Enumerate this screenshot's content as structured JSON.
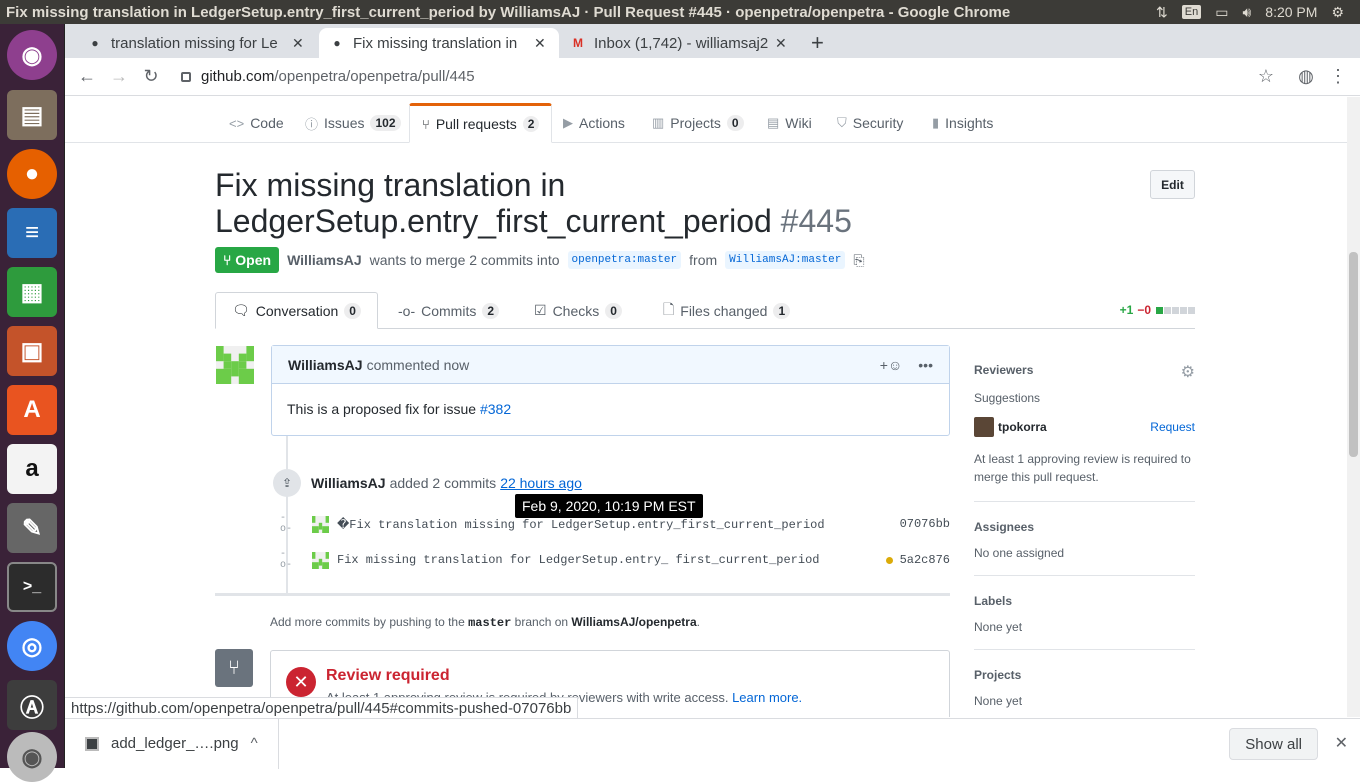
{
  "os": {
    "window_title": "Fix missing translation in LedgerSetup.entry_first_current_period by WilliamsAJ · Pull Request #445 · openpetra/openpetra - Google Chrome",
    "keyboard": "En",
    "time": "8:20 PM",
    "launcher_icons": [
      "ubuntu-icon",
      "files-icon",
      "firefox-icon",
      "writer-icon",
      "calc-icon",
      "impress-icon",
      "software-icon",
      "amazon-icon",
      "settings-icon",
      "terminal-icon",
      "chrome-icon",
      "updater-icon",
      "dvd-icon"
    ]
  },
  "browser": {
    "tabs": [
      {
        "label": "translation missing for Le",
        "favicon": "github-icon"
      },
      {
        "label": "Fix missing translation in",
        "favicon": "github-icon"
      },
      {
        "label": "Inbox (1,742) - williamsaj2",
        "favicon": "gmail-icon"
      }
    ],
    "url_host": "github.com",
    "url_path": "/openpetra/openpetra/pull/445",
    "status_url": "https://github.com/openpetra/openpetra/pull/445#commits-pushed-07076bb"
  },
  "repo_nav": [
    {
      "label": "Code",
      "icon": "<>",
      "count": ""
    },
    {
      "label": "Issues",
      "icon": "ⓘ",
      "count": "102"
    },
    {
      "label": "Pull requests",
      "icon": "⑂",
      "count": "2"
    },
    {
      "label": "Actions",
      "icon": "▶",
      "count": ""
    },
    {
      "label": "Projects",
      "icon": "▥",
      "count": "0"
    },
    {
      "label": "Wiki",
      "icon": "▤",
      "count": ""
    },
    {
      "label": "Security",
      "icon": "⛉",
      "count": ""
    },
    {
      "label": "Insights",
      "icon": "▮",
      "count": ""
    }
  ],
  "pr": {
    "title": "Fix missing translation in LedgerSetup.entry_first_current_period",
    "number": "#445",
    "edit_label": "Edit",
    "state": "Open",
    "author": "WilliamsAJ",
    "merge_text": "wants to merge 2 commits into",
    "base_branch": "openpetra:master",
    "from_text": "from",
    "head_branch": "WilliamsAJ:master"
  },
  "pr_tabs": [
    {
      "label": "Conversation",
      "icon": "🗨",
      "count": "0"
    },
    {
      "label": "Commits",
      "icon": "-o-",
      "count": "2"
    },
    {
      "label": "Checks",
      "icon": "☑",
      "count": "0"
    },
    {
      "label": "Files changed",
      "icon": "🗋",
      "count": "1"
    }
  ],
  "diffstat": {
    "additions": "+1",
    "deletions": "−0"
  },
  "comment": {
    "author": "WilliamsAJ",
    "when": "commented now",
    "body_text": "This is a proposed fix for issue",
    "issue_link": "#382"
  },
  "push_event": {
    "author": "WilliamsAJ",
    "text": "added 2 commits",
    "time": "22 hours ago",
    "tooltip": "Feb 9, 2020, 10:19 PM EST"
  },
  "commits": [
    {
      "message": "�Fix translation missing for LedgerSetup.entry_first_current_period",
      "sha": "07076bb",
      "pending": false
    },
    {
      "message": "Fix missing translation for LedgerSetup.entry_ first_current_period",
      "sha": "5a2c876",
      "pending": true
    }
  ],
  "push_note": {
    "pre": "Add more commits by pushing to the",
    "branch": "master",
    "mid": "branch on",
    "repo": "WilliamsAJ/openpetra",
    "post": "."
  },
  "merge": {
    "title": "Review required",
    "subtitle": "At least 1 approving review is required by reviewers with write access.",
    "link": "Learn more."
  },
  "sidebar": {
    "reviewers_label": "Reviewers",
    "suggestions": "Suggestions",
    "suggested_reviewer": "tpokorra",
    "request": "Request",
    "review_note": "At least 1 approving review is required to merge this pull request.",
    "assignees_label": "Assignees",
    "assignees_value": "No one assigned",
    "labels_label": "Labels",
    "labels_value": "None yet",
    "projects_label": "Projects",
    "projects_value": "None yet"
  },
  "downloads": {
    "file": "add_ledger_….png",
    "show_all": "Show all"
  }
}
